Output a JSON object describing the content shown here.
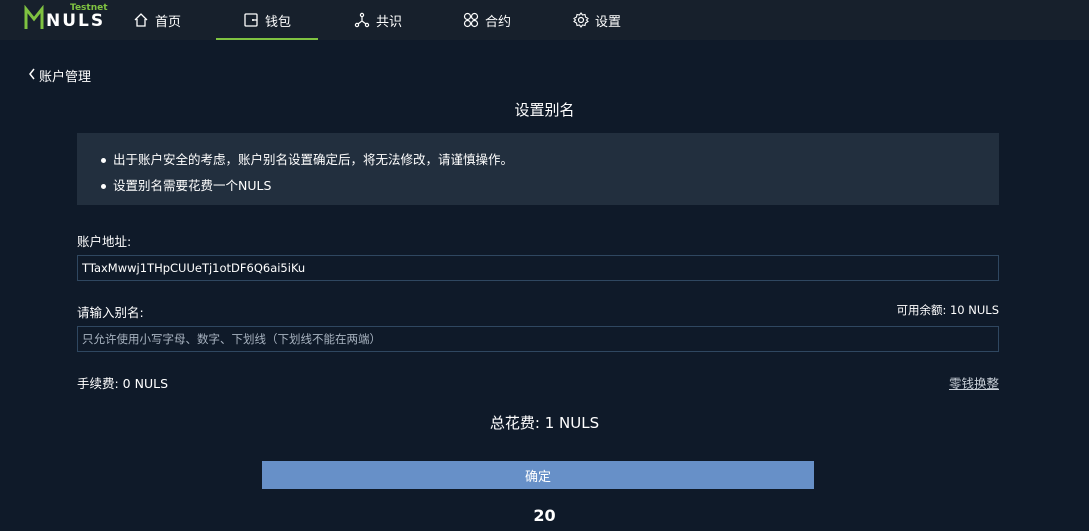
{
  "app": {
    "logo_text": "NULS",
    "logo_badge": "Testnet"
  },
  "nav": {
    "items": [
      {
        "label": "首页",
        "icon": "home-icon"
      },
      {
        "label": "钱包",
        "icon": "wallet-icon",
        "active": true
      },
      {
        "label": "共识",
        "icon": "network-nodes-icon"
      },
      {
        "label": "合约",
        "icon": "grid-circles-icon"
      },
      {
        "label": "设置",
        "icon": "gear-icon"
      }
    ]
  },
  "back": {
    "label": "账户管理",
    "icon": "chevron-left-icon"
  },
  "page": {
    "title": "设置别名"
  },
  "notice": {
    "items": [
      "出于账户安全的考虑，账户别名设置确定后，将无法修改，请谨慎操作。",
      "设置别名需要花费一个NULS"
    ]
  },
  "form": {
    "address_label": "账户地址:",
    "address_value": "TTaxMwwj1THpCUUeTj1otDF6Q6ai5iKu",
    "alias_label": "请输入别名:",
    "alias_placeholder": "只允许使用小写字母、数字、下划线（下划线不能在两端）",
    "alias_value": "",
    "balance_label": "可用余额: 10 NULS",
    "fee_label": "手续费: 0 NULS",
    "change_link": "零钱换整",
    "total_label": "总花费: 1 NULS",
    "confirm_label": "确定",
    "countdown": "20"
  },
  "colors": {
    "background": "#0f1a29",
    "topbar": "#17202c",
    "accent": "#7fc241",
    "notice_bg": "#222f3e",
    "button": "#6790c8",
    "field_border": "#2f4760"
  }
}
